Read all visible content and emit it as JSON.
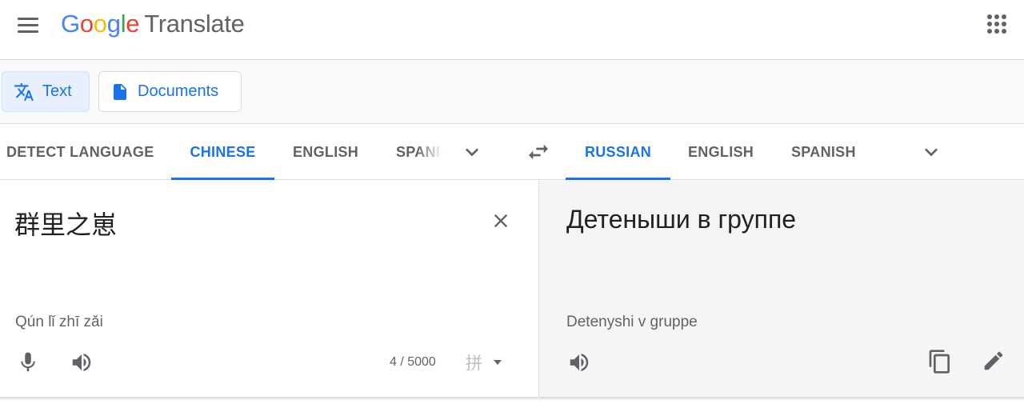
{
  "header": {
    "logo_letters": [
      {
        "ch": "G",
        "color": "#4285F4"
      },
      {
        "ch": "o",
        "color": "#EA4335"
      },
      {
        "ch": "o",
        "color": "#FBBC05"
      },
      {
        "ch": "g",
        "color": "#4285F4"
      },
      {
        "ch": "l",
        "color": "#34A853"
      },
      {
        "ch": "e",
        "color": "#EA4335"
      }
    ],
    "product": "Translate",
    "menu_icon": "hamburger-menu-icon",
    "apps_icon": "apps-grid-icon"
  },
  "modes": {
    "text": {
      "label": "Text",
      "icon": "translate-icon",
      "active": true
    },
    "documents": {
      "label": "Documents",
      "icon": "document-icon",
      "active": false
    }
  },
  "source_langs": {
    "detect": "DETECT LANGUAGE",
    "chinese": "CHINESE",
    "english": "ENGLISH",
    "spanish": "SPANISH",
    "active": "chinese"
  },
  "target_langs": {
    "russian": "RUSSIAN",
    "english": "ENGLISH",
    "spanish": "SPANISH",
    "active": "russian"
  },
  "source": {
    "text": "群里之崽",
    "transliteration": "Qún lǐ zhī zǎi",
    "char_count": "4 / 5000",
    "ime_char": "拼"
  },
  "target": {
    "text": "Детеныши в группе",
    "transliteration": "Detenyshi v gruppe"
  },
  "colors": {
    "accent": "#1a73e8",
    "text_secondary": "#5f6368",
    "target_bg": "#f5f5f5"
  }
}
